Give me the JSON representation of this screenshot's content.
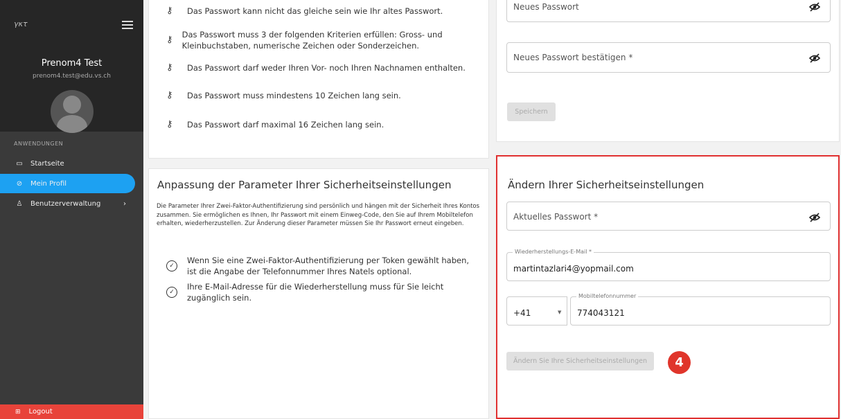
{
  "sidebar": {
    "logo": "γκτ",
    "user_name": "Prenom4 Test",
    "user_email": "prenom4.test@edu.vs.ch",
    "section_label": "ANWENDUNGEN",
    "items": [
      {
        "label": "Startseite",
        "icon": "home-icon"
      },
      {
        "label": "Mein Profil",
        "icon": "shield-icon"
      },
      {
        "label": "Benutzerverwaltung",
        "icon": "users-icon"
      }
    ],
    "logout_label": "Logout"
  },
  "password_rules": [
    "Das Passwort kann nicht das gleiche sein wie Ihr altes Passwort.",
    "Das Passwort muss 3 der folgenden Kriterien erfüllen: Gross- und Kleinbuchstaben, numerische Zeichen oder Sonderzeichen.",
    "Das Passwort darf weder Ihren Vor- noch Ihren Nachnamen enthalten.",
    "Das Passwort muss mindestens 10 Zeichen lang sein.",
    "Das Passwort darf maximal 16 Zeichen lang sein."
  ],
  "security_params": {
    "title": "Anpassung der Parameter Ihrer Sicherheitseinstellungen",
    "description": "Die Parameter Ihrer Zwei-Faktor-Authentifizierung sind persönlich und hängen mit der Sicherheit Ihres Kontos zusammen. Sie ermöglichen es Ihnen, Ihr Passwort mit einem Einweg-Code, den Sie auf Ihrem Mobiltelefon erhalten, wiederherzustellen. Zur Änderung dieser Parameter müssen Sie Ihr Passwort erneut eingeben.",
    "checks": [
      "Wenn Sie eine Zwei-Faktor-Authentifizierung per Token gewählt haben, ist die Angabe der Telefonnummer Ihres Natels optional.",
      "Ihre E-Mail-Adresse für die Wiederherstellung muss für Sie leicht zugänglich sein."
    ]
  },
  "password_form": {
    "new_password_placeholder": "Neues Passwort",
    "confirm_placeholder": "Neues Passwort bestätigen *",
    "save_label": "Speichern"
  },
  "security_form": {
    "title": "Ändern Ihrer Sicherheitseinstellungen",
    "current_password_placeholder": "Aktuelles Passwort *",
    "recovery_email_label": "Wiederherstellungs-E-Mail *",
    "recovery_email_value": "martintazlari4@yopmail.com",
    "country_code": "+41",
    "mobile_label": "Mobiltelefonnummer",
    "mobile_value": "774043121",
    "submit_label": "Ändern Sie Ihre Sicherheitseinstellungen"
  },
  "step_badge": "4",
  "colors": {
    "accent": "#1da1f2",
    "logout": "#e8433a",
    "highlight": "#e03030"
  }
}
